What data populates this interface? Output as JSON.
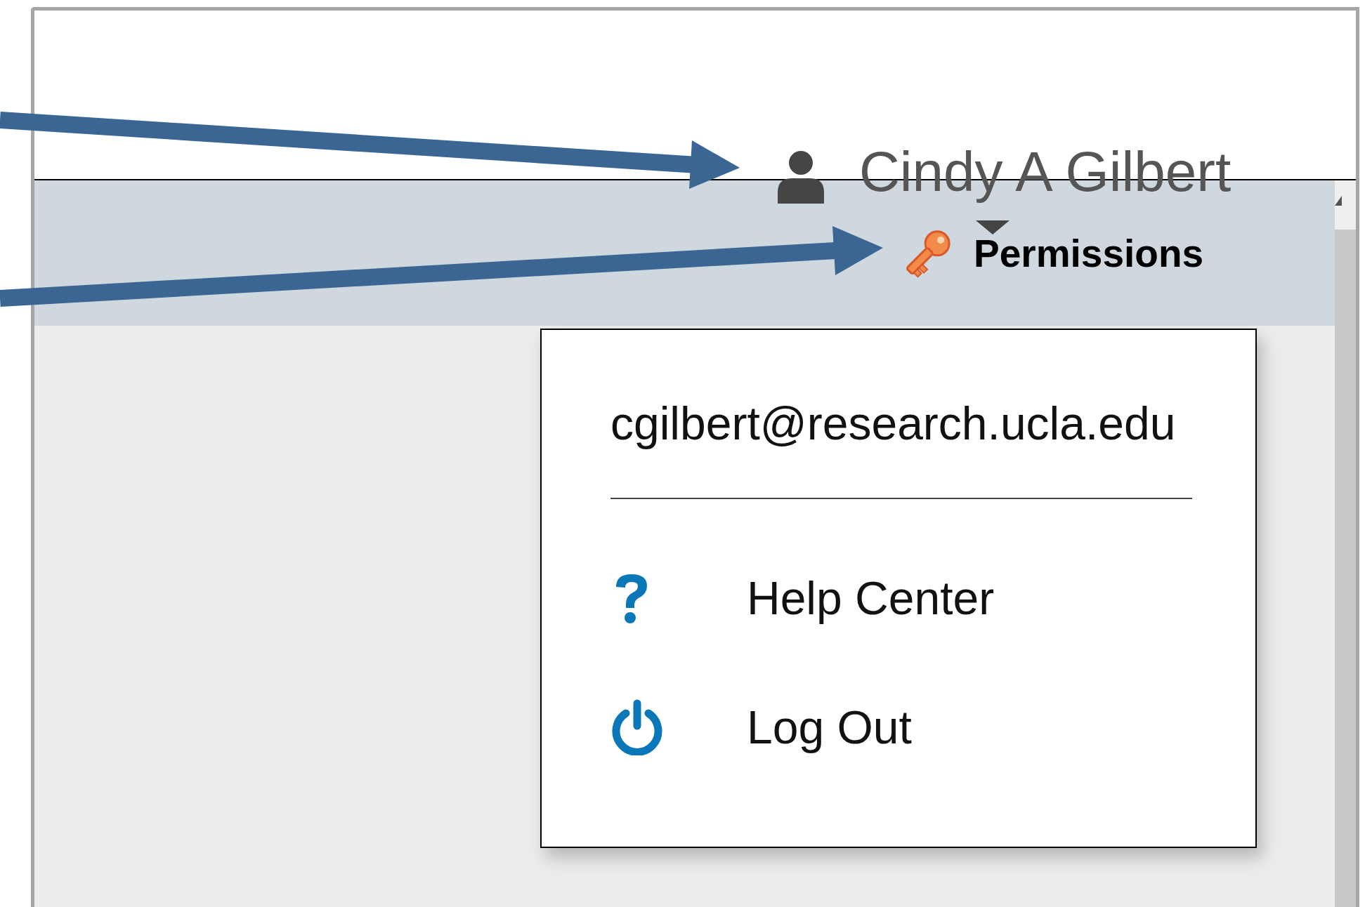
{
  "header": {
    "user_name": "Cindy A Gilbert",
    "permissions": "Permissions"
  },
  "user_menu": {
    "email": "cgilbert@research.ucla.edu",
    "items": [
      {
        "kind": "help",
        "label": "Help Center"
      },
      {
        "kind": "logout",
        "label": "Log Out"
      }
    ]
  }
}
